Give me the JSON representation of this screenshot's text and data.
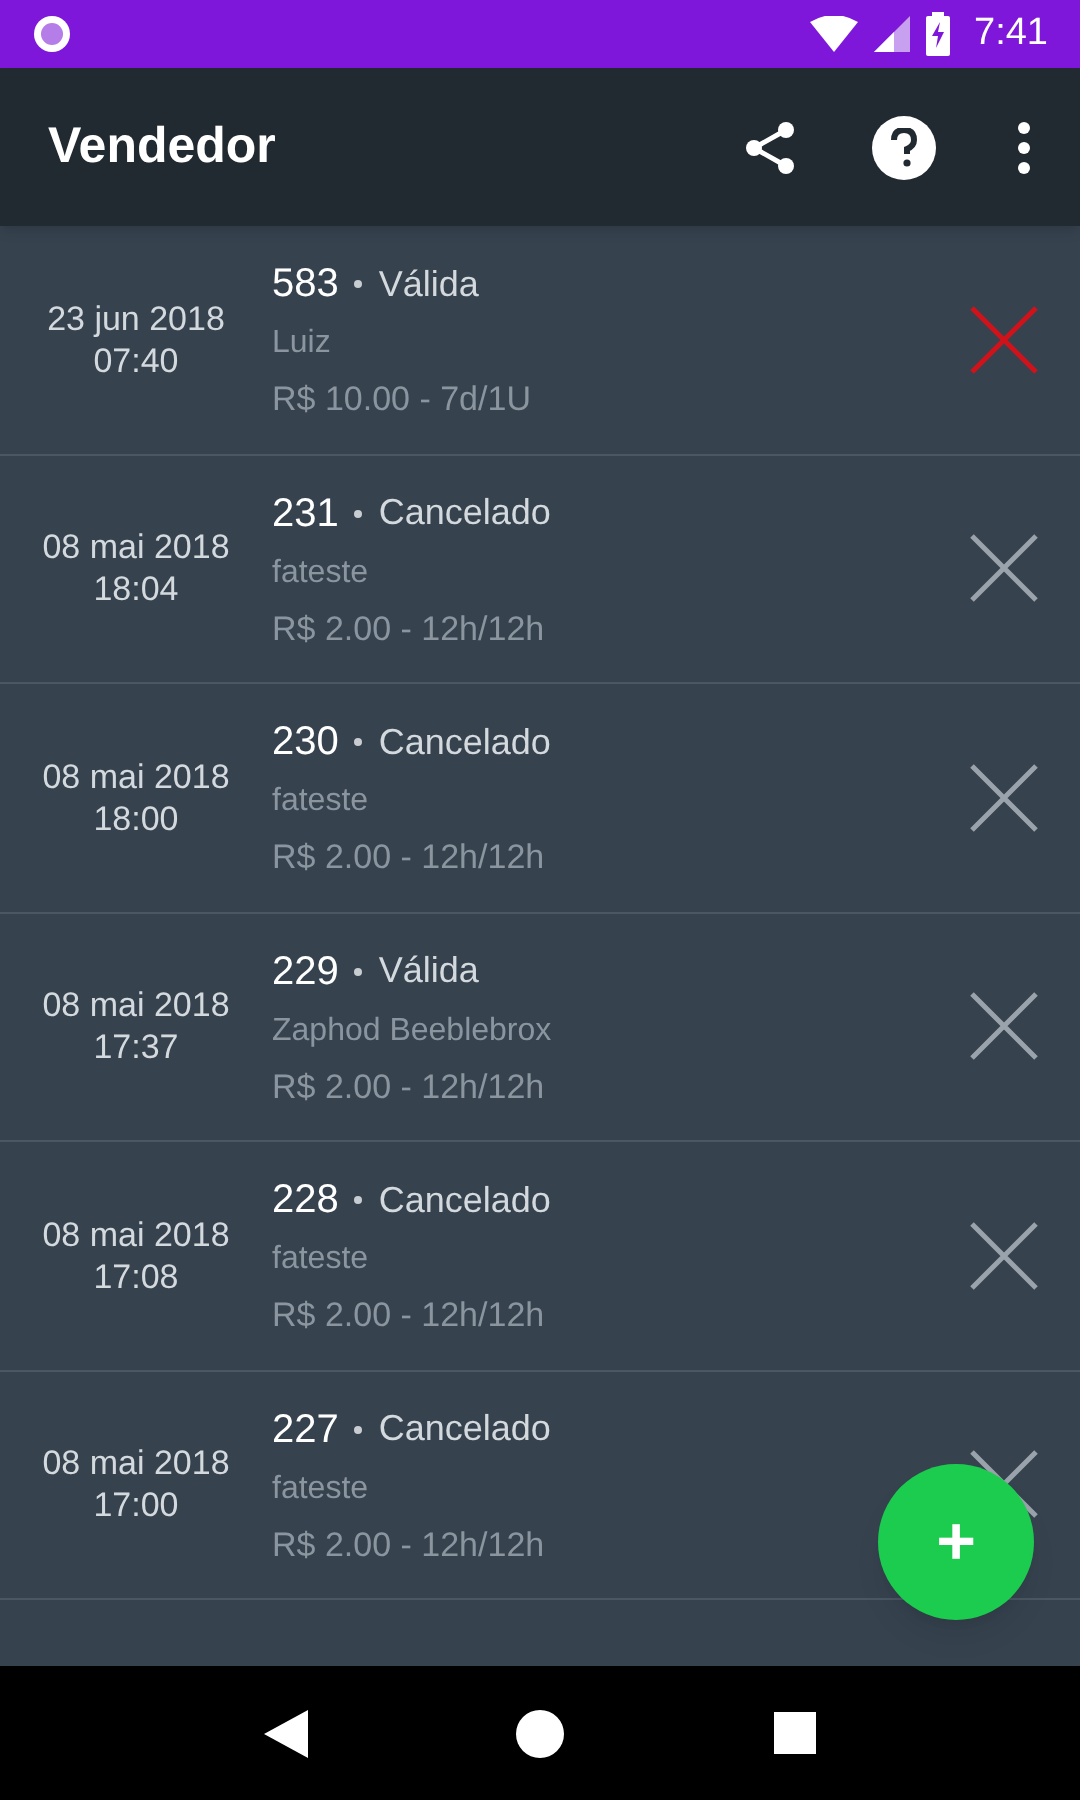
{
  "status_bar": {
    "time": "7:41"
  },
  "toolbar": {
    "title": "Vendedor"
  },
  "vouchers": [
    {
      "date": "23 jun 2018",
      "time": "07:40",
      "number": "583",
      "status": "Válida",
      "customer": "Luiz",
      "price": "R$ 10.00 - 7d/1U",
      "cancelable": true
    },
    {
      "date": "08 mai 2018",
      "time": "18:04",
      "number": "231",
      "status": "Cancelado",
      "customer": "fateste",
      "price": "R$ 2.00 - 12h/12h",
      "cancelable": false
    },
    {
      "date": "08 mai 2018",
      "time": "18:00",
      "number": "230",
      "status": "Cancelado",
      "customer": "fateste",
      "price": "R$ 2.00 - 12h/12h",
      "cancelable": false
    },
    {
      "date": "08 mai 2018",
      "time": "17:37",
      "number": "229",
      "status": "Válida",
      "customer": "Zaphod Beeblebrox",
      "price": "R$ 2.00 - 12h/12h",
      "cancelable": false
    },
    {
      "date": "08 mai 2018",
      "time": "17:08",
      "number": "228",
      "status": "Cancelado",
      "customer": "fateste",
      "price": "R$ 2.00 - 12h/12h",
      "cancelable": false
    },
    {
      "date": "08 mai 2018",
      "time": "17:00",
      "number": "227",
      "status": "Cancelado",
      "customer": "fateste",
      "price": "R$ 2.00 - 12h/12h",
      "cancelable": false
    }
  ],
  "fab": {
    "label": "+"
  }
}
